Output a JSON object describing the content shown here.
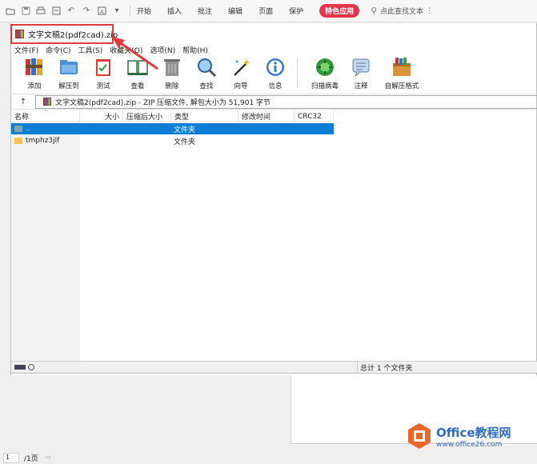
{
  "wps": {
    "tabs": [
      "开始",
      "插入",
      "批注",
      "编辑",
      "页面",
      "保护"
    ],
    "special_tab": "特色应用",
    "search_text": "点此查找文本"
  },
  "rar": {
    "title": "文字文稿2(pdf2cad).zip",
    "menu": [
      "文件(F)",
      "命令(C)",
      "工具(S)",
      "收藏夹(O)",
      "选项(N)",
      "帮助(H)"
    ],
    "tools": [
      {
        "label": "添加",
        "icon": "add-books-icon"
      },
      {
        "label": "解压到",
        "icon": "extract-folder-icon"
      },
      {
        "label": "测试",
        "icon": "test-clipboard-icon"
      },
      {
        "label": "查看",
        "icon": "view-book-icon"
      },
      {
        "label": "删除",
        "icon": "trash-icon"
      },
      {
        "label": "查找",
        "icon": "find-magnifier-icon"
      },
      {
        "label": "向导",
        "icon": "wizard-wand-icon"
      },
      {
        "label": "信息",
        "icon": "info-icon"
      },
      {
        "label": "扫描病毒",
        "icon": "virus-scan-icon"
      },
      {
        "label": "注释",
        "icon": "comment-icon"
      },
      {
        "label": "自解压格式",
        "icon": "sfx-box-icon"
      }
    ],
    "address": "文字文稿2(pdf2cad).zip - ZIP 压缩文件, 解包大小为 51,901 字节",
    "columns": [
      "名称",
      "大小",
      "压缩后大小",
      "类型",
      "修改时间",
      "CRC32"
    ],
    "rows": [
      {
        "name": "..",
        "type": "文件夹"
      },
      {
        "name": "tmphz3jlf",
        "type": "文件夹"
      }
    ],
    "status_right": "总计 1 个文件夹"
  },
  "watermark": {
    "main": "Office教程网",
    "sub": "www.office26.com"
  },
  "page_nav": {
    "current": "1",
    "total": "/1页"
  }
}
